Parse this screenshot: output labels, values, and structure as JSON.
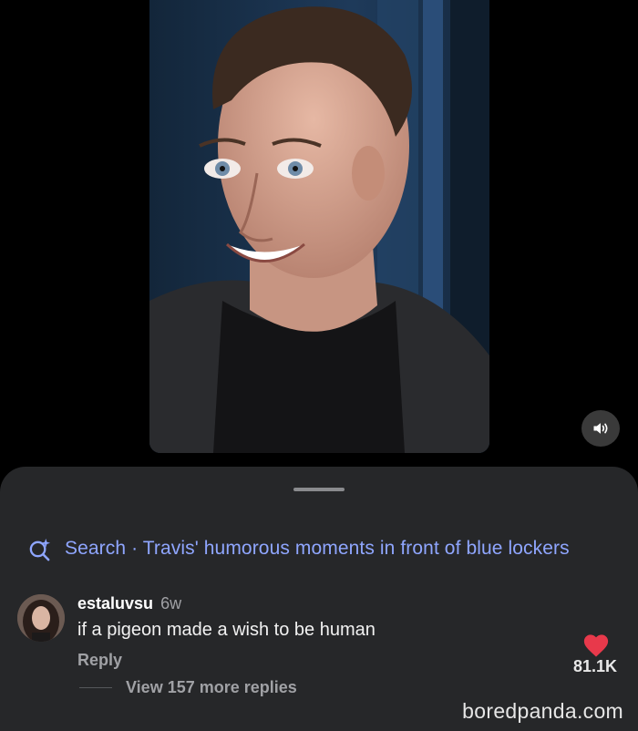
{
  "video": {
    "sound_icon": "speaker-icon"
  },
  "search": {
    "icon": "sparkle-search-icon",
    "prefix": "Search",
    "separator": "·",
    "query": "Travis' humorous moments in front of blue lockers"
  },
  "comment": {
    "username": "estaluvsu",
    "time": "6w",
    "text": "if a pigeon made a wish to be human",
    "reply_label": "Reply",
    "likes": "81.1K",
    "view_replies": "View 157 more replies"
  },
  "watermark": "boredpanda.com",
  "colors": {
    "accent": "#8fa6ff",
    "like": "#e8394b",
    "sheet": "#262729"
  }
}
